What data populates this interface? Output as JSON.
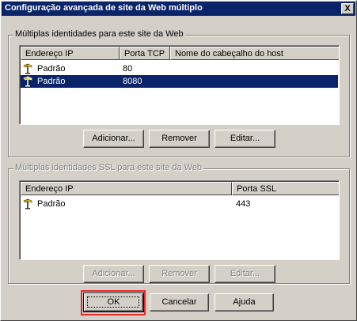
{
  "window": {
    "title": "Configuração avançada de site da Web múltiplo",
    "close_label": "X"
  },
  "group_http": {
    "label": "Múltiplas identidades para este site da Web",
    "columns": [
      "Endereço IP",
      "Porta TCP",
      "Nome do cabeçalho do host"
    ],
    "rows": [
      {
        "ip": "Padrão",
        "port": "80",
        "host": "",
        "selected": false
      },
      {
        "ip": "Padrão",
        "port": "8080",
        "host": "",
        "selected": true
      }
    ],
    "buttons": {
      "add": "Adicionar...",
      "remove": "Remover",
      "edit": "Editar..."
    }
  },
  "group_ssl": {
    "label": "Múltiplas identidades SSL para este site da Web",
    "columns": [
      "Endereço IP",
      "Porta SSL"
    ],
    "rows": [
      {
        "ip": "Padrão",
        "port": "443"
      }
    ],
    "buttons": {
      "add": "Adicionar...",
      "remove": "Remover",
      "edit": "Editar..."
    }
  },
  "footer": {
    "ok": "OK",
    "cancel": "Cancelar",
    "help": "Ajuda"
  },
  "colors": {
    "title_bar": "#0a246a",
    "selection": "#0a246a",
    "dialog_bg": "#d4d0c8",
    "highlight": "#e8262b"
  }
}
